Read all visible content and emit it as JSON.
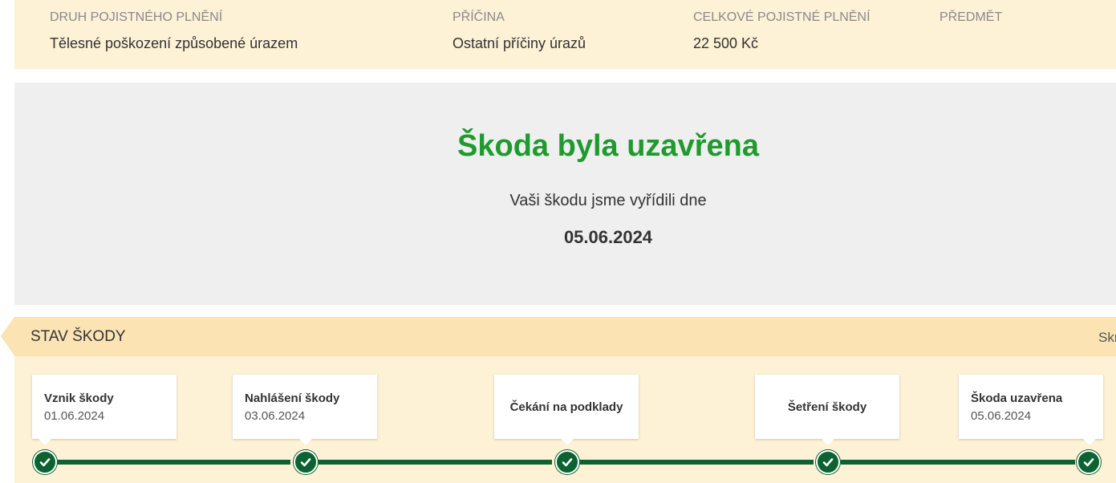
{
  "info": {
    "columns": [
      {
        "label": "DRUH POJISTNÉHO PLNĚNÍ",
        "value": "Tělesné poškození způsobené úrazem"
      },
      {
        "label": "PŘÍČINA",
        "value": "Ostatní příčiny úrazů"
      },
      {
        "label": "CELKOVÉ POJISTNÉ PLNĚNÍ",
        "value": "22 500 Kč"
      },
      {
        "label": "PŘEDMĚT",
        "value": ""
      }
    ]
  },
  "status": {
    "title": "Škoda byla uzavřena",
    "subtitle": "Vaši škodu jsme vyřídili dne",
    "date": "05.06.2024"
  },
  "stav": {
    "title": "STAV ŠKODY",
    "toggle_label": "Skr"
  },
  "timeline": {
    "steps": [
      {
        "title": "Vznik škody",
        "date": "01.06.2024",
        "done": true
      },
      {
        "title": "Nahlášení škody",
        "date": "03.06.2024",
        "done": true
      },
      {
        "title": "Čekání na podklady",
        "date": "",
        "done": true
      },
      {
        "title": "Šetření škody",
        "date": "",
        "done": true
      },
      {
        "title": "Škoda uzavřena",
        "date": "05.06.2024",
        "done": true
      }
    ]
  },
  "colors": {
    "accent_green": "#1f9a2e",
    "timeline_green": "#0c6331",
    "panel_cream": "#fdf1d6",
    "header_tan": "#fbe3b4",
    "status_gray": "#efefef"
  },
  "icons": {
    "step_done": "check-circle-icon",
    "header_pointer": "arrow-left-icon"
  }
}
